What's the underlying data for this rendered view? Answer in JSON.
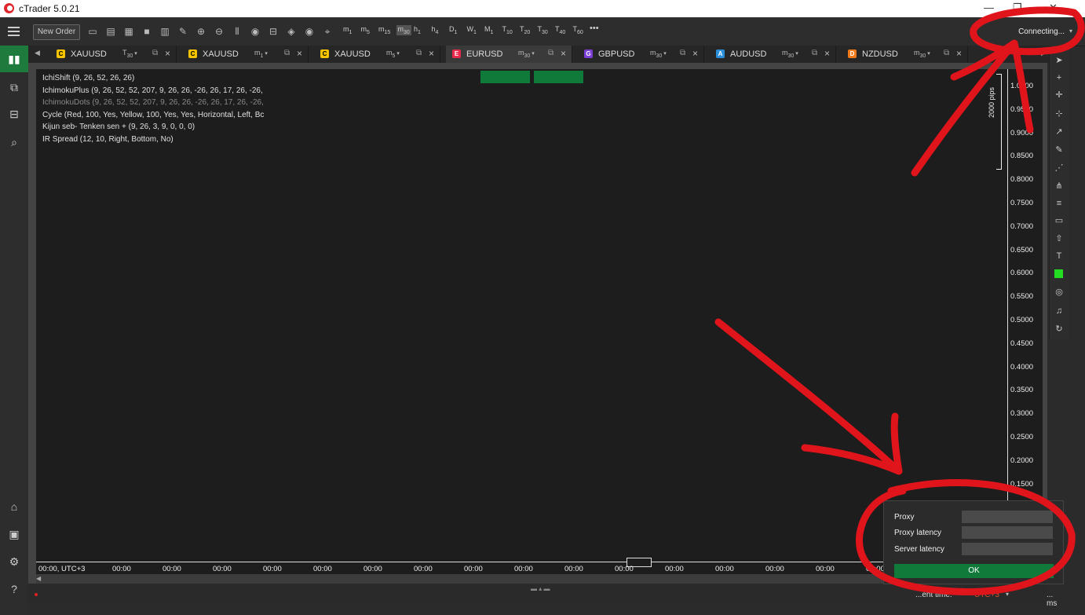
{
  "app": {
    "title": "cTrader 5.0.21"
  },
  "window_controls": [
    "—",
    "❐",
    "✕"
  ],
  "toolbar": {
    "new_order_label": "New Order",
    "icons": [
      "monitor-icon",
      "layout-icon",
      "grid-icon",
      "single-chart-icon",
      "split-icon",
      "chart-edit-icon",
      "zoom-in-icon",
      "zoom-out-icon",
      "candles-icon",
      "ctrader-icon",
      "bot-icon",
      "layers-icon",
      "eye-icon",
      "crosshair-icon"
    ],
    "timeframes": [
      {
        "l": "m",
        "s": "1"
      },
      {
        "l": "m",
        "s": "5"
      },
      {
        "l": "m",
        "s": "15"
      },
      {
        "l": "m",
        "s": "30",
        "selected": true
      },
      {
        "l": "h",
        "s": "1"
      },
      {
        "l": "h",
        "s": "4"
      },
      {
        "l": "D",
        "s": "1"
      },
      {
        "l": "W",
        "s": "1"
      },
      {
        "l": "M",
        "s": "1"
      },
      {
        "l": "T",
        "s": "10"
      },
      {
        "l": "T",
        "s": "20"
      },
      {
        "l": "T",
        "s": "30"
      },
      {
        "l": "T",
        "s": "40"
      },
      {
        "l": "T",
        "s": "60"
      }
    ],
    "more_label": "•••",
    "connection_status": "Connecting...",
    "connection_caret": "▾"
  },
  "sidebar": {
    "top": [
      {
        "name": "trade",
        "icon": "candles-icon",
        "active": true
      },
      {
        "name": "copy",
        "icon": "copy-icon"
      },
      {
        "name": "algo",
        "icon": "bot-icon"
      },
      {
        "name": "analyze",
        "icon": "search-chart-icon"
      }
    ],
    "bottom": [
      {
        "name": "bank",
        "icon": "bank-icon"
      },
      {
        "name": "wallet",
        "icon": "wallet-icon"
      },
      {
        "name": "settings",
        "icon": "gear-icon"
      },
      {
        "name": "help",
        "icon": "help-icon"
      }
    ]
  },
  "tabs": [
    {
      "letter": "C",
      "symbol": "XAUUSD",
      "tf_l": "T",
      "tf_s": "30",
      "color": "#f5c400"
    },
    {
      "letter": "C",
      "symbol": "XAUUSD",
      "tf_l": "m",
      "tf_s": "1",
      "color": "#f5c400"
    },
    {
      "letter": "C",
      "symbol": "XAUUSD",
      "tf_l": "m",
      "tf_s": "5",
      "color": "#f5c400"
    },
    {
      "letter": "E",
      "symbol": "EURUSD",
      "tf_l": "m",
      "tf_s": "30",
      "color": "#e8294c",
      "active": true
    },
    {
      "letter": "G",
      "symbol": "GBPUSD",
      "tf_l": "m",
      "tf_s": "30",
      "color": "#7b3fd6"
    },
    {
      "letter": "A",
      "symbol": "AUDUSD",
      "tf_l": "m",
      "tf_s": "30",
      "color": "#2a8fd8"
    },
    {
      "letter": "D",
      "symbol": "NZDUSD",
      "tf_l": "m",
      "tf_s": "30",
      "color": "#f07a1a"
    }
  ],
  "indicators": [
    {
      "text": "IchiShift (9, 26, 52, 26, 26)",
      "dim": false
    },
    {
      "text": "IchimokuPlus (9, 26, 52, 52, 207, 9, 26, 26, -26, 26, 17, 26, -26,",
      "dim": false
    },
    {
      "text": "IchimokuDots (9, 26, 52, 52, 207, 9, 26, 26, -26, 26, 17, 26, -26,",
      "dim": true
    },
    {
      "text": "Cycle (Red, 100, Yes, Yellow, 100, Yes, Yes, Horizontal, Left, Bc",
      "dim": false
    },
    {
      "text": "Kijun seb- Tenken sen + (9, 26, 3, 9, 0, 0, 0)",
      "dim": false
    },
    {
      "text": "IR Spread (12, 10, Right, Bottom, No)",
      "dim": false
    }
  ],
  "y_axis": [
    "1.0000",
    "0.9500",
    "0.9000",
    "0.8500",
    "0.8000",
    "0.7500",
    "0.7000",
    "0.6500",
    "0.6000",
    "0.5500",
    "0.5000",
    "0.4500",
    "0.4000",
    "0.3500",
    "0.3000",
    "0.2500",
    "0.2000",
    "0.1500"
  ],
  "pips_label": "2000 pips",
  "x_axis": [
    "00:00, UTC+3",
    "00:00",
    "00:00",
    "00:00",
    "00:00",
    "00:00",
    "00:00",
    "00:00",
    "00:00",
    "00:00",
    "00:00",
    "00:00",
    "00:00",
    "00:00",
    "00:00",
    "00:00",
    "00:00"
  ],
  "status": {
    "current_time_label": "...ent time:",
    "timezone": "UTC+3",
    "timezone_caret": "▾",
    "latency": "... ms"
  },
  "popup": {
    "proxy_label": "Proxy",
    "proxy_latency_label": "Proxy latency",
    "server_latency_label": "Server latency",
    "ok_label": "OK"
  },
  "annotation_color": "#e0141b"
}
